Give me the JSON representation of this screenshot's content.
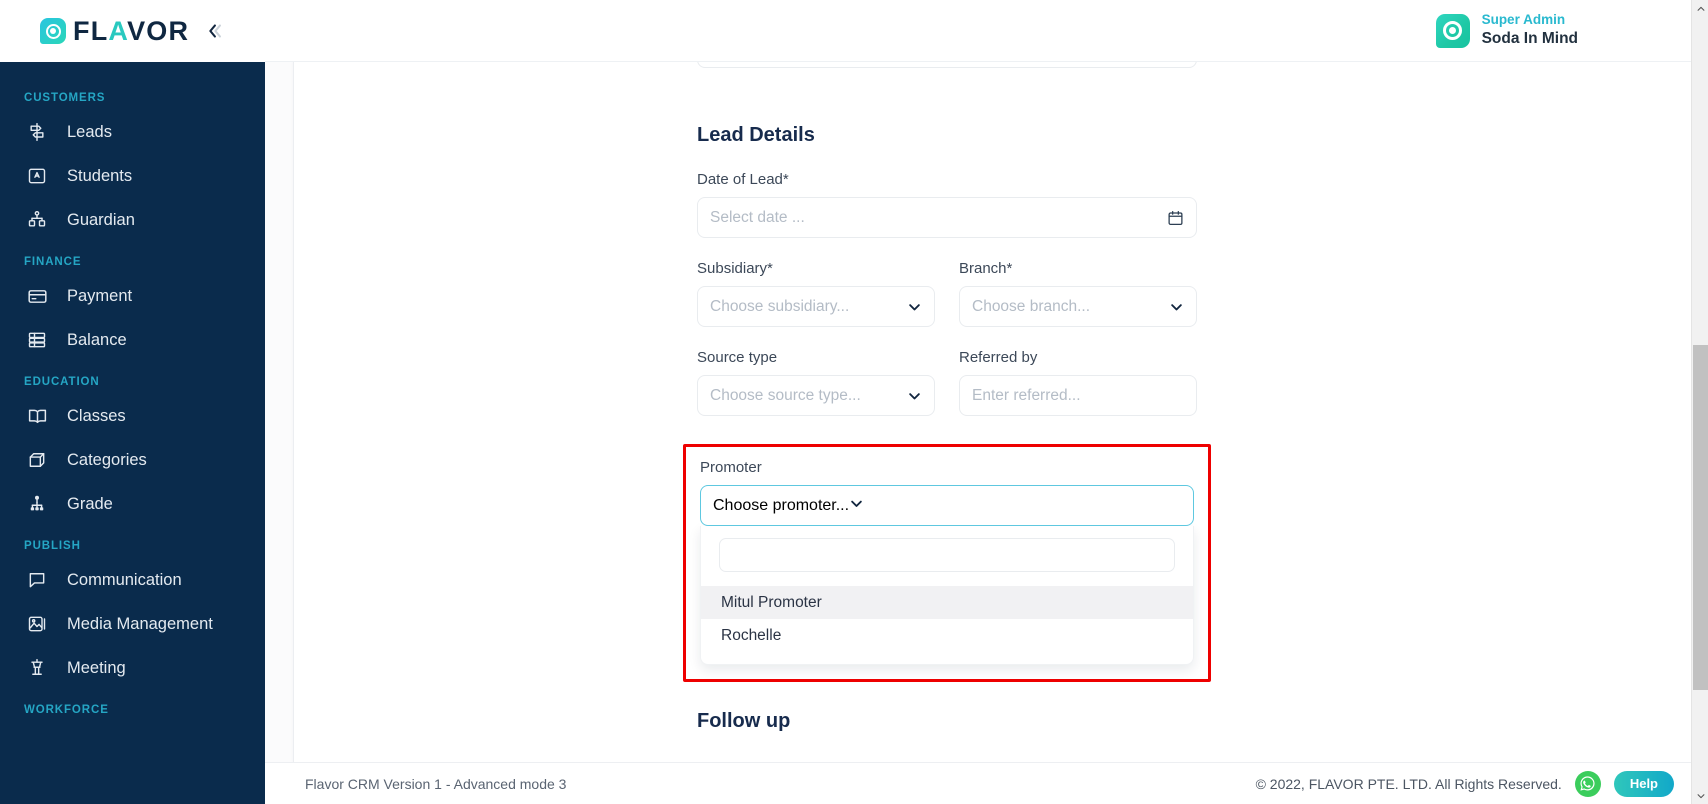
{
  "brand": {
    "logo_text_pre": "FL",
    "logo_text_accent": "A",
    "logo_text_post": "VOR",
    "collapse_icon": "double-chevron-left-icon"
  },
  "header": {
    "user_role": "Super Admin",
    "user_name": "Soda In Mind"
  },
  "sidebar": {
    "groups": [
      {
        "label": "CUSTOMERS",
        "items": [
          {
            "label": "Leads",
            "icon": "signpost-icon"
          },
          {
            "label": "Students",
            "icon": "id-card-icon"
          },
          {
            "label": "Guardian",
            "icon": "hierarchy-icon"
          }
        ]
      },
      {
        "label": "FINANCE",
        "items": [
          {
            "label": "Payment",
            "icon": "credit-card-icon"
          },
          {
            "label": "Balance",
            "icon": "coins-stack-icon"
          }
        ]
      },
      {
        "label": "EDUCATION",
        "items": [
          {
            "label": "Classes",
            "icon": "open-book-icon"
          },
          {
            "label": "Categories",
            "icon": "box-icon"
          },
          {
            "label": "Grade",
            "icon": "org-chart-icon"
          }
        ]
      },
      {
        "label": "PUBLISH",
        "items": [
          {
            "label": "Communication",
            "icon": "chat-bubble-icon"
          },
          {
            "label": "Media Management",
            "icon": "image-icon"
          },
          {
            "label": "Meeting",
            "icon": "podium-icon"
          }
        ]
      },
      {
        "label": "WORKFORCE",
        "items": []
      }
    ]
  },
  "form": {
    "lead_details_title": "Lead Details",
    "date_of_lead": {
      "label": "Date of Lead*",
      "placeholder": "Select date ...",
      "value": "",
      "icon": "calendar-icon"
    },
    "subsidiary": {
      "label": "Subsidiary*",
      "placeholder": "Choose subsidiary...",
      "value": "",
      "icon": "chevron-down-icon"
    },
    "branch": {
      "label": "Branch*",
      "placeholder": "Choose branch...",
      "value": "",
      "icon": "chevron-down-icon"
    },
    "source_type": {
      "label": "Source type",
      "placeholder": "Choose source type...",
      "value": "",
      "icon": "chevron-down-icon"
    },
    "referred_by": {
      "label": "Referred by",
      "placeholder": "Enter referred...",
      "value": ""
    },
    "promoter": {
      "label": "Promoter",
      "placeholder": "Choose promoter...",
      "value": "",
      "icon": "chevron-down-icon",
      "search_value": "",
      "search_placeholder": "",
      "options": [
        {
          "label": "Mitul Promoter",
          "highlighted": true
        },
        {
          "label": "Rochelle",
          "highlighted": false
        }
      ]
    },
    "follow_up_title": "Follow up"
  },
  "footer": {
    "version_text": "Flavor CRM Version 1 - Advanced mode 3",
    "copyright": "© 2022, FLAVOR PTE. LTD. All Rights Reserved.",
    "whatsapp_icon": "whatsapp-icon",
    "help_label": "Help"
  },
  "colors": {
    "sidebar_bg": "#0a2b4c",
    "group_label": "#25a6c4",
    "accent_teal": "#29c9bf",
    "highlight_red": "#ee0000",
    "focus_blue": "#5ec8e0",
    "title_navy": "#172b4d"
  }
}
